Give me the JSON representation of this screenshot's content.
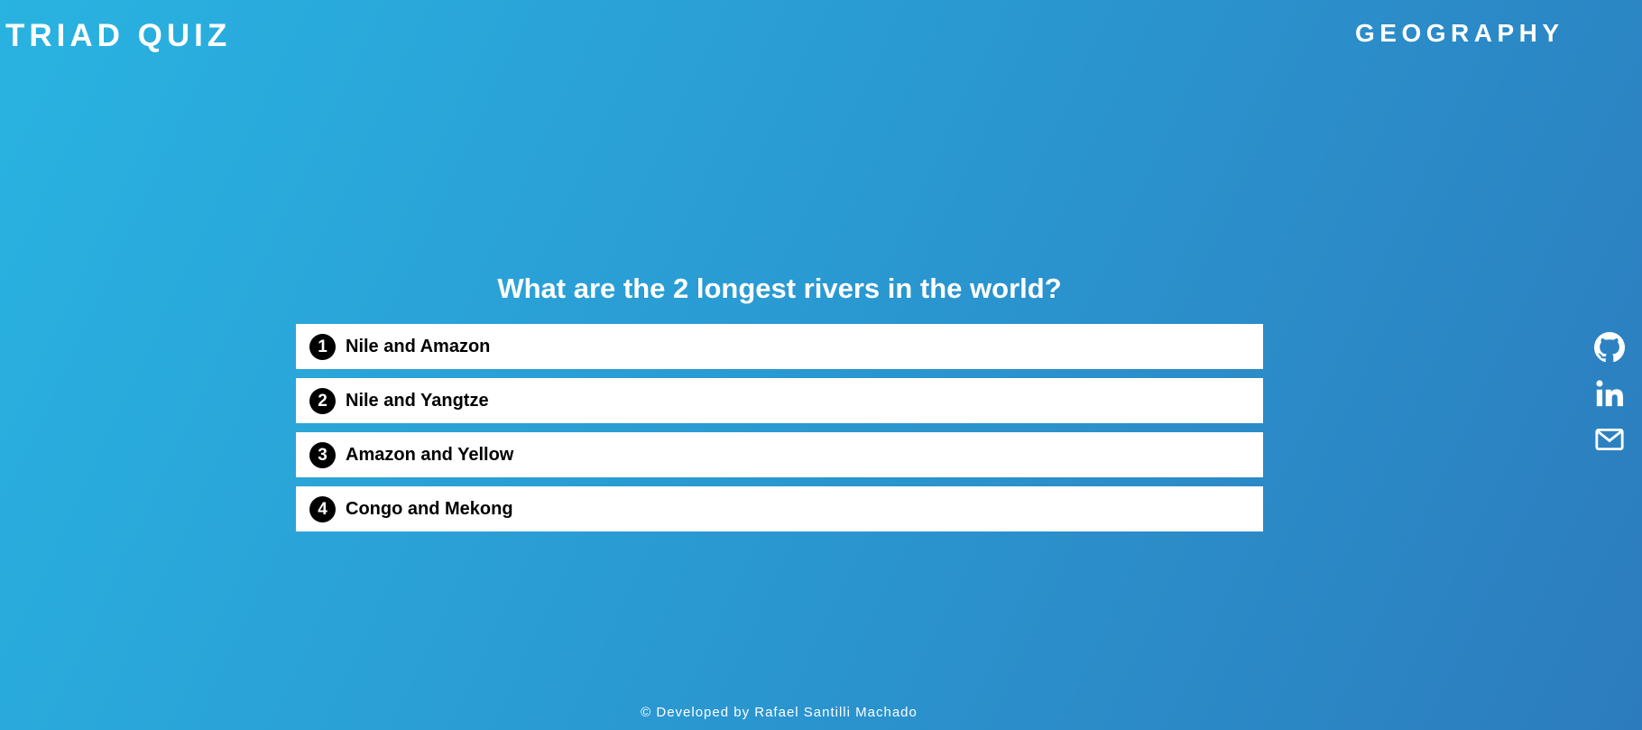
{
  "header": {
    "brand": "TRIAD QUIZ",
    "category": "GEOGRAPHY"
  },
  "quiz": {
    "question": "What are the 2 longest rivers in the world?",
    "options": [
      {
        "number": "1",
        "text": "Nile and Amazon"
      },
      {
        "number": "2",
        "text": "Nile and Yangtze"
      },
      {
        "number": "3",
        "text": "Amazon and Yellow"
      },
      {
        "number": "4",
        "text": "Congo and Mekong"
      }
    ]
  },
  "social": {
    "icons": [
      "github-icon",
      "linkedin-icon",
      "mail-icon"
    ]
  },
  "footer": {
    "credit": "© Developed by Rafael Santilli Machado"
  },
  "colors": {
    "gradient_start": "#29b3e1",
    "gradient_end": "#2c7cbd",
    "option_background": "#ffffff",
    "number_badge": "#000000"
  }
}
